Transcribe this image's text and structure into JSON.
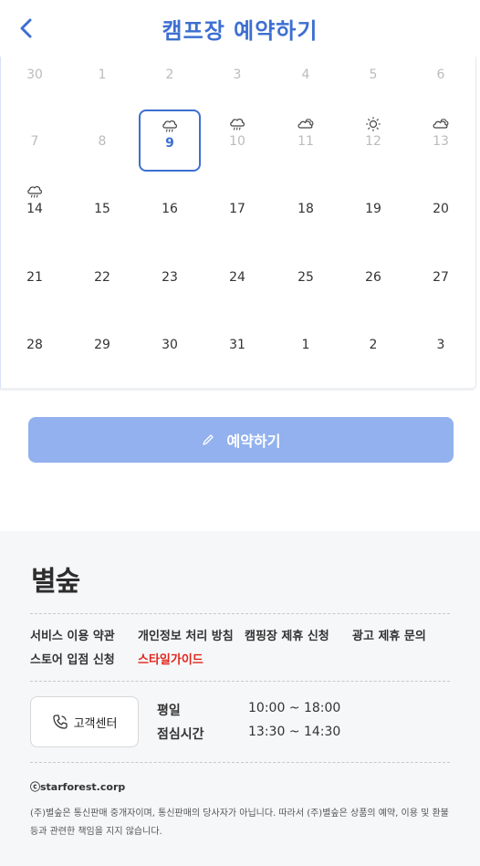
{
  "header": {
    "title": "캠프장 예약하기"
  },
  "calendar": {
    "rows": [
      [
        {
          "day": "30",
          "dim": true
        },
        {
          "day": "1",
          "dim": true
        },
        {
          "day": "2",
          "dim": true
        },
        {
          "day": "3",
          "dim": true
        },
        {
          "day": "4",
          "dim": true
        },
        {
          "day": "5",
          "dim": true
        },
        {
          "day": "6",
          "dim": true
        }
      ],
      [
        {
          "day": "7",
          "dim": true
        },
        {
          "day": "8",
          "dim": true
        },
        {
          "day": "9",
          "selected": true,
          "weather": "rain-cloud-icon"
        },
        {
          "day": "10",
          "dim": true,
          "weather": "rain-cloud-icon"
        },
        {
          "day": "11",
          "dim": true,
          "weather": "cloudy-icon"
        },
        {
          "day": "12",
          "dim": true,
          "weather": "sun-icon"
        },
        {
          "day": "13",
          "dim": true,
          "weather": "cloudy-icon"
        }
      ],
      [
        {
          "day": "14",
          "weather": "rain-cloud-icon"
        },
        {
          "day": "15"
        },
        {
          "day": "16"
        },
        {
          "day": "17"
        },
        {
          "day": "18"
        },
        {
          "day": "19"
        },
        {
          "day": "20"
        }
      ],
      [
        {
          "day": "21"
        },
        {
          "day": "22"
        },
        {
          "day": "23"
        },
        {
          "day": "24"
        },
        {
          "day": "25"
        },
        {
          "day": "26"
        },
        {
          "day": "27"
        }
      ],
      [
        {
          "day": "28"
        },
        {
          "day": "29"
        },
        {
          "day": "30"
        },
        {
          "day": "31"
        },
        {
          "day": "1"
        },
        {
          "day": "2"
        },
        {
          "day": "3"
        }
      ]
    ]
  },
  "reserve_button": {
    "label": "예약하기",
    "icon": "pencil-icon"
  },
  "footer": {
    "logo": "별숲",
    "links": [
      {
        "label": "서비스 이용 약관"
      },
      {
        "label": "개인정보 처리 방침"
      },
      {
        "label": "캠핑장 제휴 신청"
      },
      {
        "label": "광고 제휴 문의"
      },
      {
        "label": "스토어 입점 신청"
      },
      {
        "label": "스타일가이드",
        "highlight": true
      }
    ],
    "customer_center": {
      "label": "고객센터",
      "icon": "phone-icon"
    },
    "hours": [
      {
        "label": "평일",
        "value": "10:00 ~ 18:00"
      },
      {
        "label": "점심시간",
        "value": "13:30 ~ 14:30"
      }
    ],
    "copyright": "ⓒstarforest.corp",
    "notice": "(주)별숲은 통신판매 중개자이며, 통신판매의 당사자가 아닙니다. 따라서 (주)별숲은 상품의 예약, 이용 및 환불 등과 관련한 책임을 지지 않습니다."
  },
  "colors": {
    "accent": "#3d6fd1",
    "button": "#92b1ee",
    "highlight_link": "#e1251b"
  }
}
